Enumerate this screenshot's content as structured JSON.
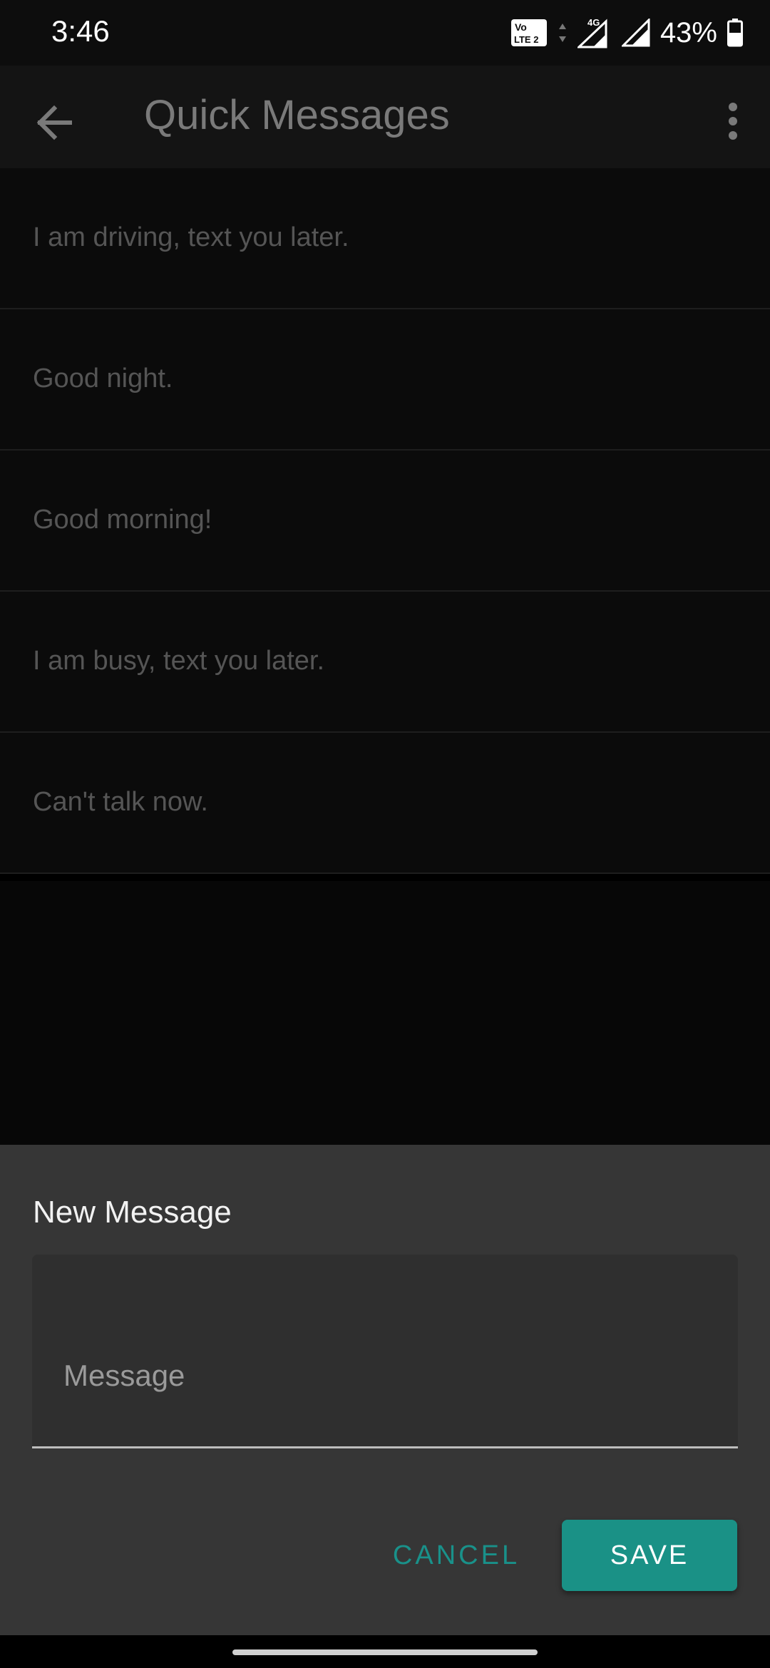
{
  "status_bar": {
    "time": "3:46",
    "battery_percent": "43%",
    "icons": [
      "volte-icon",
      "data-arrows-icon",
      "signal-4g-icon",
      "signal-icon",
      "battery-icon"
    ],
    "volte_label_top": "Vo",
    "volte_label_bottom": "LTE 2",
    "network_label": "4G"
  },
  "app_bar": {
    "title": "Quick Messages",
    "back_icon": "arrow-back-icon",
    "menu_icon": "more-vert-icon"
  },
  "messages": [
    {
      "text": "I am driving, text you later."
    },
    {
      "text": "Good night."
    },
    {
      "text": "Good morning!"
    },
    {
      "text": "I am busy, text you later."
    },
    {
      "text": "Can't talk now."
    }
  ],
  "dialog": {
    "title": "New Message",
    "input_placeholder": "Message",
    "input_value": "",
    "cancel_label": "CANCEL",
    "save_label": "SAVE"
  },
  "colors": {
    "accent": "#1a9186",
    "background": "#0b0b0b",
    "sheet": "#363636"
  }
}
